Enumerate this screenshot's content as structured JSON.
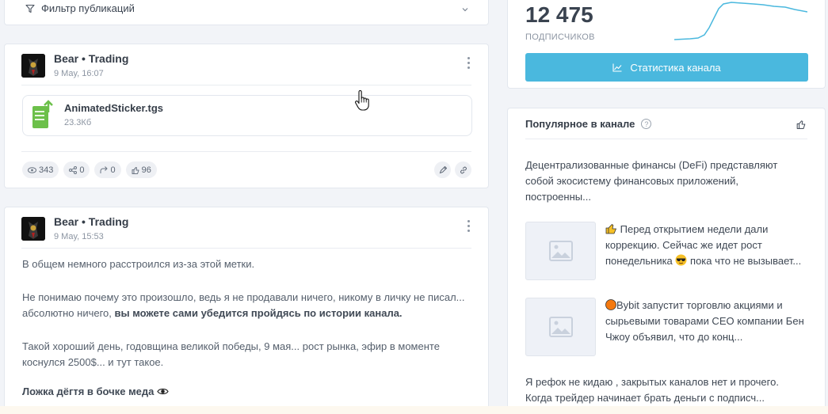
{
  "filter": {
    "label": "Фильтр публикаций",
    "icon": "filter-icon"
  },
  "post1": {
    "author": "Bear • Trading",
    "date": "9 May, 16:07",
    "file": {
      "name": "AnimatedSticker.tgs",
      "size": "23.3Кб"
    },
    "stats": {
      "views": "343",
      "shares": "0",
      "forwards": "0",
      "likes": "96"
    }
  },
  "post2": {
    "author": "Bear • Trading",
    "date": "9 May, 15:53",
    "p1": "В общем немного расстроился из-за этой метки.",
    "p2": "Не понимаю почему это произошло, ведь я не продавали ничего, никому в личку не писал...",
    "p2b_plain": "абсолютно ничего, ",
    "p2b_bold": "вы можете сами убедится пройдясь по истории канала.",
    "p3a": "Такой хороший день, годовщина великой победы, 9 мая... рост рынка, эфир в моменте",
    "p3b": "коснулся 2500$... и тут такое.",
    "p4": "Ложка дёгтя в бочке меда"
  },
  "stats": {
    "subscribers": "12 475",
    "subscribers_label": "ПОДПИСЧИКОВ",
    "button_label": "Статистика канала",
    "accent": "#4ab8de"
  },
  "popular": {
    "title": "Популярное в канале",
    "item1_l1": "Децентрализованные финансы (DeFi) представляют",
    "item1_l2": "собой экосистему финансовых приложений,",
    "item1_l3": "построенны...",
    "item2_l1": "Перед открытием недели дали",
    "item2_l2": "коррекцию. Сейчас же идет рост",
    "item2_l3a": "понедельника",
    "item2_l3b": "пока что не вызывает...",
    "item3_l1": "Bybit запустит торговлю акциями и",
    "item3_l2": "сырьевыми товарами CEO компании Бен",
    "item3_l3": "Чжоу объявил, что до конц...",
    "item4_l1": "Я рефок не кидаю , закрытых каналов нет и прочего.",
    "item4_l2": "Когда трейдер начинает брать деньги с подписч..."
  }
}
